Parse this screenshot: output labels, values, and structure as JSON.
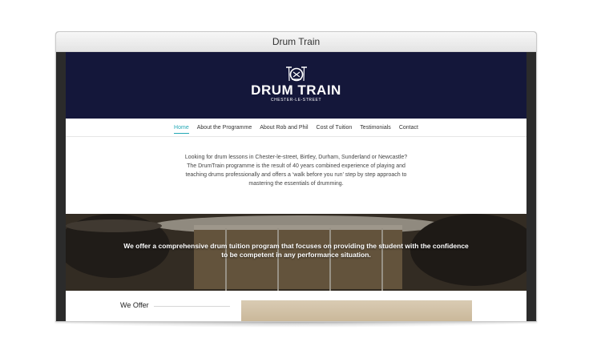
{
  "window": {
    "title": "Drum Train"
  },
  "site": {
    "logo": {
      "name": "DRUM TRAIN",
      "tagline": "CHESTER-LE-STREET",
      "icon": "drum-kit-icon"
    },
    "nav": [
      {
        "label": "Home",
        "active": true
      },
      {
        "label": "About the Programme",
        "active": false
      },
      {
        "label": "About Rob and Phil",
        "active": false
      },
      {
        "label": "Cost of Tuition",
        "active": false
      },
      {
        "label": "Testimonials",
        "active": false
      },
      {
        "label": "Contact",
        "active": false
      }
    ],
    "intro": {
      "line1": "Looking for drum lessons in Chester-le-street, Birtley, Durham, Sunderland or Newcastle?",
      "line2": "The DrumTrain programme is the result of 40 years combined experience of playing and teaching drums professionally and offers a ‘walk before you run’ step by step approach to mastering the essentials of drumming."
    },
    "hero": {
      "text": "We offer a comprehensive drum tuition program that focuses on providing the student with the confidence to be competent in any performance situation."
    },
    "offer": {
      "title": "We Offer"
    },
    "colors": {
      "header_bg": "#14173a",
      "accent": "#24a9b6"
    }
  }
}
